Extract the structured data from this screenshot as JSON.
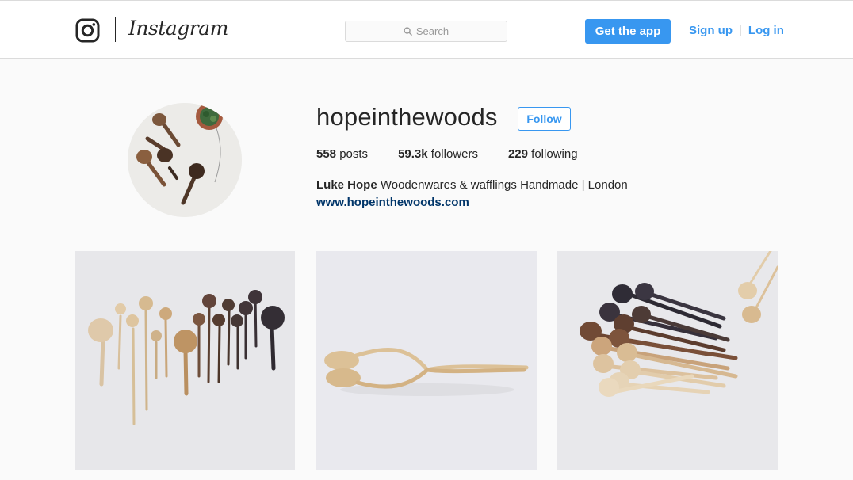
{
  "header": {
    "logo_icon": "instagram-camera-icon",
    "wordmark": "Instagram",
    "search_placeholder": "Search",
    "get_app_label": "Get the app",
    "signup_label": "Sign up",
    "separator": "|",
    "login_label": "Log in",
    "accent_color": "#3897f0"
  },
  "profile": {
    "username": "hopeinthewoods",
    "follow_label": "Follow",
    "stats": {
      "posts_count": "558",
      "posts_label": "posts",
      "followers_count": "59.3k",
      "followers_label": "followers",
      "following_count": "229",
      "following_label": "following"
    },
    "full_name": "Luke Hope",
    "bio": "Woodenwares & wafflings Handmade | London",
    "website": "www.hopeinthewoods.com"
  },
  "posts": [
    {
      "subject": "spoon-row"
    },
    {
      "subject": "twisted-spoons"
    },
    {
      "subject": "spoon-pile"
    }
  ]
}
